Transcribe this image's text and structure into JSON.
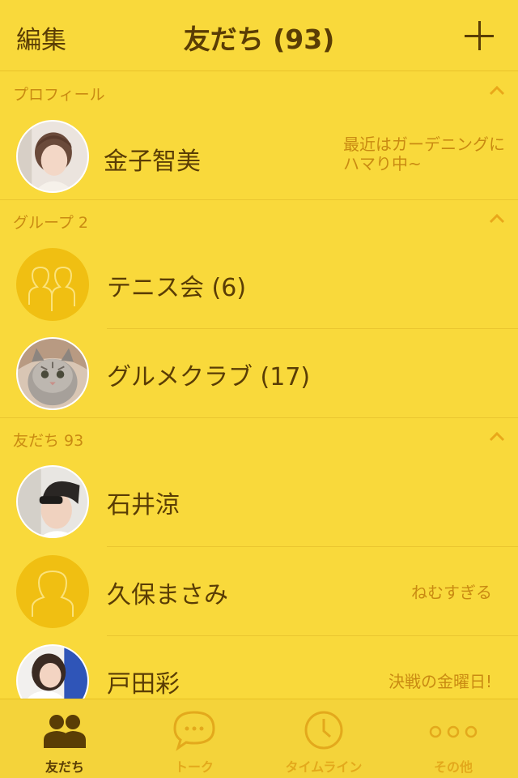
{
  "header": {
    "edit_label": "編集",
    "title": "友だち (93)",
    "add_icon": "plus-icon"
  },
  "sections": {
    "profile": {
      "label": "プロフィール"
    },
    "groups": {
      "label": "グループ 2"
    },
    "friends": {
      "label": "友だち 93"
    }
  },
  "profile": {
    "name": "金子智美",
    "status": "最近はガーデニングにハマり中~"
  },
  "groups": [
    {
      "name": "テニス会 (6)",
      "avatar": "group-placeholder-icon"
    },
    {
      "name": "グルメクラブ (17)",
      "avatar": "cat-photo"
    }
  ],
  "friends": [
    {
      "name": "石井涼",
      "status": "",
      "avatar": "photo"
    },
    {
      "name": "久保まさみ",
      "status": "ねむすぎる",
      "avatar": "person-placeholder-icon"
    },
    {
      "name": "戸田彩",
      "status": "決戦の金曜日!",
      "avatar": "photo"
    }
  ],
  "tabbar": {
    "items": [
      {
        "label": "友だち",
        "icon": "friends-icon",
        "active": true
      },
      {
        "label": "トーク",
        "icon": "chat-bubble-icon",
        "active": false
      },
      {
        "label": "タイムライン",
        "icon": "clock-icon",
        "active": false
      },
      {
        "label": "その他",
        "icon": "more-dots-icon",
        "active": false
      }
    ]
  },
  "colors": {
    "background": "#f9d93b",
    "text": "#5a3d05",
    "accent": "#c98a12",
    "tab_inactive": "#e3a91c"
  }
}
